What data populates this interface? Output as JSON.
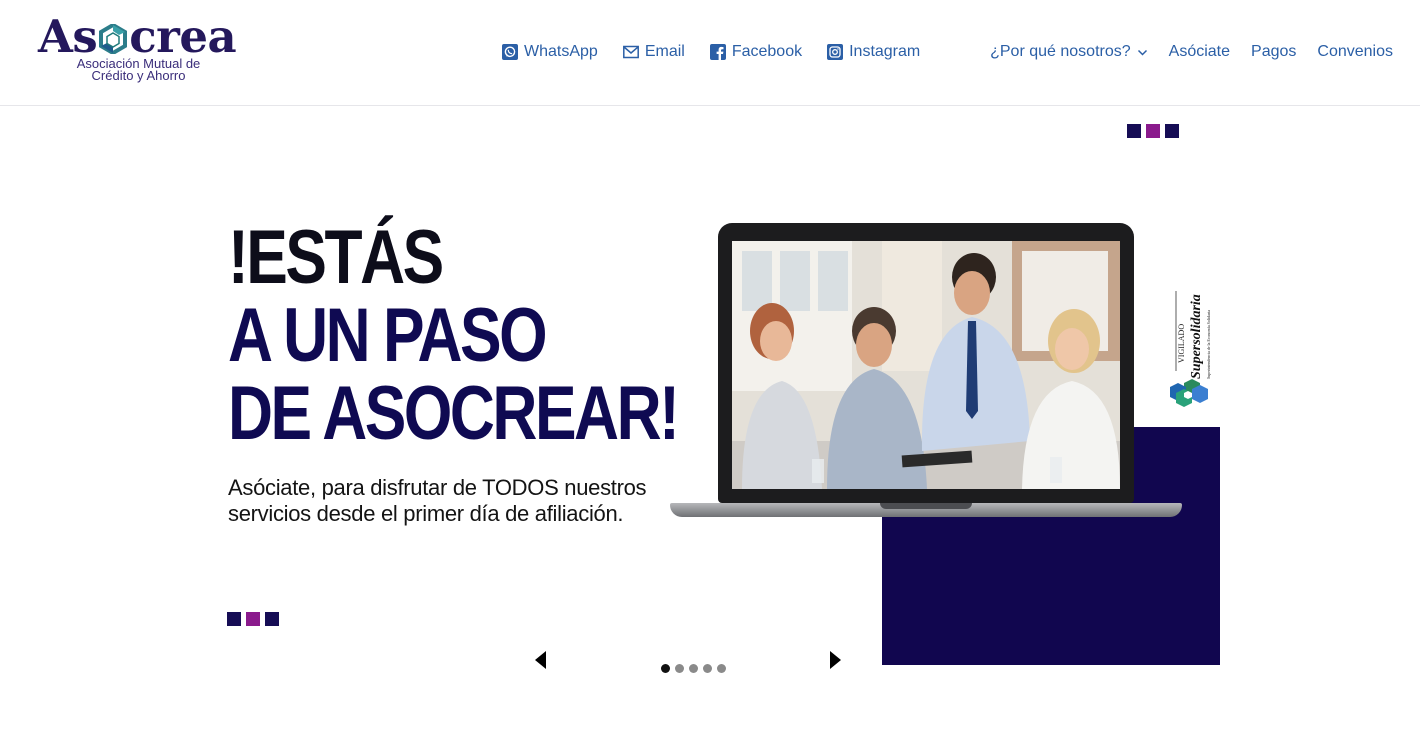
{
  "brand": {
    "name": "Asocrea",
    "name_part1": "As",
    "name_part2": "crea",
    "subtitle_line1": "Asociación Mutual de",
    "subtitle_line2": "Crédito y Ahorro",
    "color_primary": "#24185c",
    "color_accent": "#2b5fa6"
  },
  "social_links": [
    {
      "label": "WhatsApp",
      "icon": "whatsapp-icon"
    },
    {
      "label": "Email",
      "icon": "email-icon"
    },
    {
      "label": "Facebook",
      "icon": "facebook-icon"
    },
    {
      "label": "Instagram",
      "icon": "instagram-icon"
    }
  ],
  "main_nav": [
    {
      "label": "¿Por qué nosotros?",
      "has_dropdown": true
    },
    {
      "label": "Asóciate"
    },
    {
      "label": "Pagos"
    },
    {
      "label": "Convenios"
    }
  ],
  "hero": {
    "headline_line1": "!ESTÁS",
    "headline_line2": "A UN PASO",
    "headline_line3": "DE ASOCREAR!",
    "subtext": "Asóciate, para disfrutar de TODOS nuestros servicios desde el primer día de afiliación.",
    "badge_vigilado": "VIGILADO",
    "badge_org": "Supersolidaria",
    "badge_caption": "Superintendencia de la Economía Solidaria",
    "color_navy": "#11064f",
    "color_purple": "#8a1a8c"
  },
  "slider": {
    "total_slides": 5,
    "active_slide": 1
  }
}
